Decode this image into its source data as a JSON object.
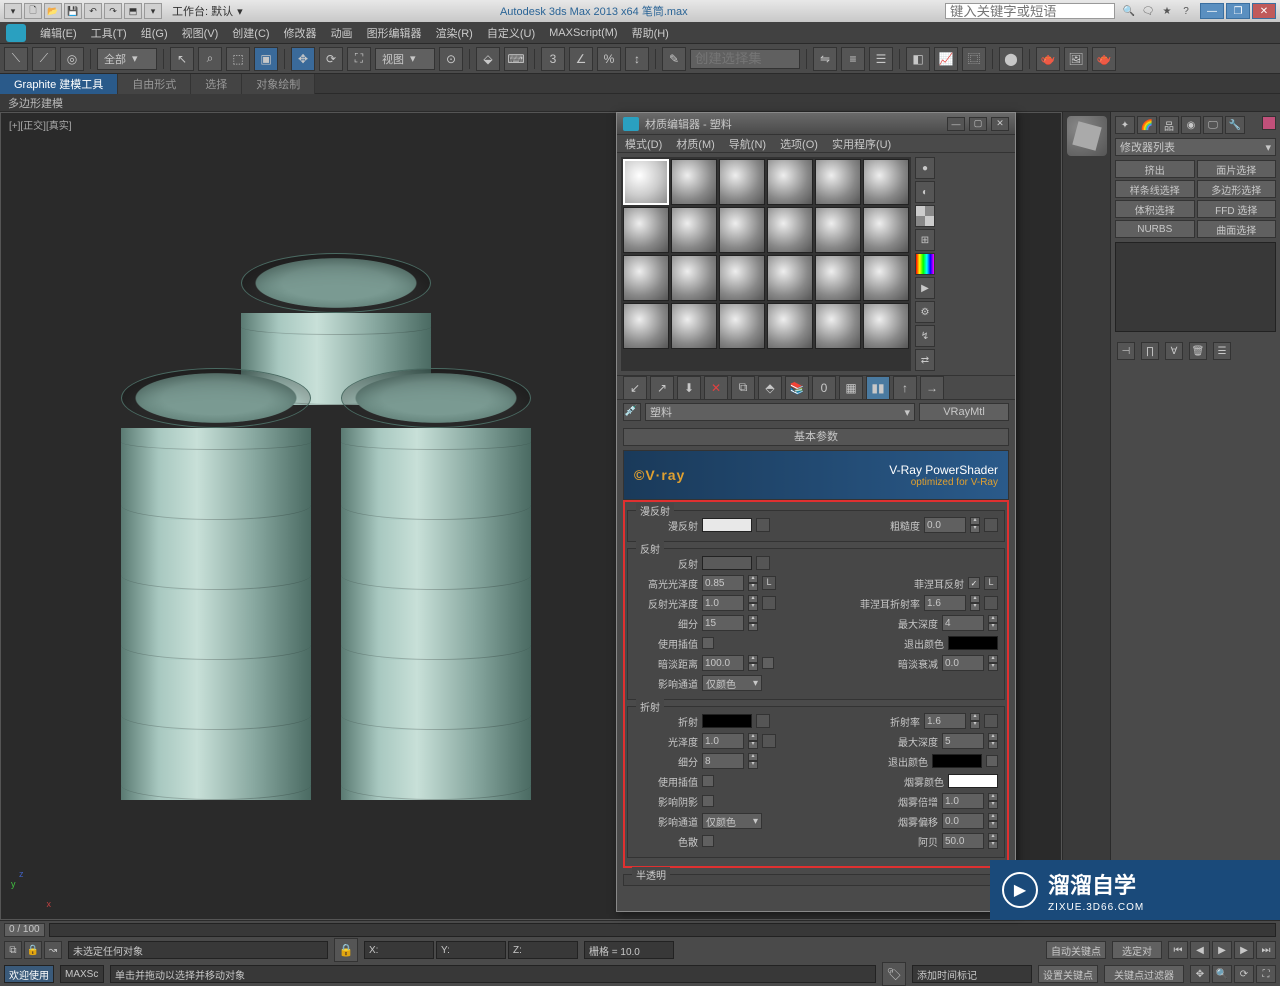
{
  "titlebar": {
    "workspace_label": "工作台: 默认",
    "title": "Autodesk 3ds Max  2013 x64    笔筒.max",
    "search_placeholder": "键入关键字或短语"
  },
  "menubar": {
    "items": [
      "编辑(E)",
      "工具(T)",
      "组(G)",
      "视图(V)",
      "创建(C)",
      "修改器",
      "动画",
      "图形编辑器",
      "渲染(R)",
      "自定义(U)",
      "MAXScript(M)",
      "帮助(H)"
    ]
  },
  "toolbar": {
    "filter_dd": "全部",
    "view_dd": "视图",
    "selection_set": "创建选择集"
  },
  "graphite": {
    "tabs": [
      "Graphite 建模工具",
      "自由形式",
      "选择",
      "对象绘制"
    ],
    "ribbon": "多边形建模"
  },
  "viewport": {
    "label": "[+][正交][真实]"
  },
  "right_panel": {
    "modifier_list": "修改器列表",
    "buttons": [
      "挤出",
      "面片选择",
      "样条线选择",
      "多边形选择",
      "体积选择",
      "FFD 选择",
      "NURBS",
      "曲面选择"
    ]
  },
  "material_editor": {
    "title": "材质编辑器 - 塑料",
    "menu": [
      "模式(D)",
      "材质(M)",
      "导航(N)",
      "选项(O)",
      "实用程序(U)"
    ],
    "material_name": "塑料",
    "material_type": "VRayMtl",
    "rollout1": "基本参数",
    "vray_banner": {
      "logo": "©V·ray",
      "line1": "V-Ray PowerShader",
      "line2": "optimized for V-Ray"
    },
    "diffuse": {
      "legend": "漫反射",
      "label_diffuse": "漫反射",
      "label_rough": "粗糙度",
      "rough_val": "0.0"
    },
    "reflect": {
      "legend": "反射",
      "label_reflect": "反射",
      "label_hilight": "高光光泽度",
      "hilight_val": "0.85",
      "lock": "L",
      "label_rglossy": "反射光泽度",
      "rglossy_val": "1.0",
      "label_fresnel": "菲涅耳反射",
      "lock2": "L",
      "label_fresnel_ior": "菲涅耳折射率",
      "fresnel_ior_val": "1.6",
      "label_subdiv": "细分",
      "subdiv_val": "15",
      "label_maxdepth": "最大深度",
      "maxdepth_val": "4",
      "label_interp": "使用插值",
      "label_exit": "退出颜色",
      "label_dimdist": "暗淡距离",
      "dimdist_val": "100.0",
      "label_dimfall": "暗淡衰减",
      "dimfall_val": "0.0",
      "label_affect": "影响通道",
      "affect_val": "仅颜色"
    },
    "refract": {
      "legend": "折射",
      "label_refract": "折射",
      "label_ior": "折射率",
      "ior_val": "1.6",
      "label_glossy": "光泽度",
      "glossy_val": "1.0",
      "label_maxdepth": "最大深度",
      "maxdepth_val": "5",
      "label_subdiv": "细分",
      "subdiv_val": "8",
      "label_exit": "退出颜色",
      "label_interp": "使用插值",
      "label_fogcolor": "烟雾颜色",
      "label_shadows": "影响阴影",
      "label_fogmult": "烟雾倍增",
      "fogmult_val": "1.0",
      "label_affect": "影响通道",
      "affect_val": "仅颜色",
      "label_fogbias": "烟雾偏移",
      "fogbias_val": "0.0",
      "label_disp": "色散",
      "label_abbe": "阿贝",
      "abbe_val": "50.0"
    },
    "translucency": {
      "legend": "半透明"
    }
  },
  "timeline": {
    "frame": "0 / 100"
  },
  "status": {
    "welcome": "欢迎使用",
    "script": "MAXSc",
    "line1": "未选定任何对象",
    "line2": "单击并拖动以选择并移动对象",
    "x": "X:",
    "y": "Y:",
    "z": "Z:",
    "grid": "栅格 = 10.0",
    "add_time_tag": "添加时间标记",
    "auto_key": "自动关键点",
    "sel_dd": "选定对",
    "set_key": "设置关键点",
    "key_filter": "关键点过滤器"
  },
  "watermark": {
    "brand": "溜溜自学",
    "url": "ZIXUE.3D66.COM"
  }
}
